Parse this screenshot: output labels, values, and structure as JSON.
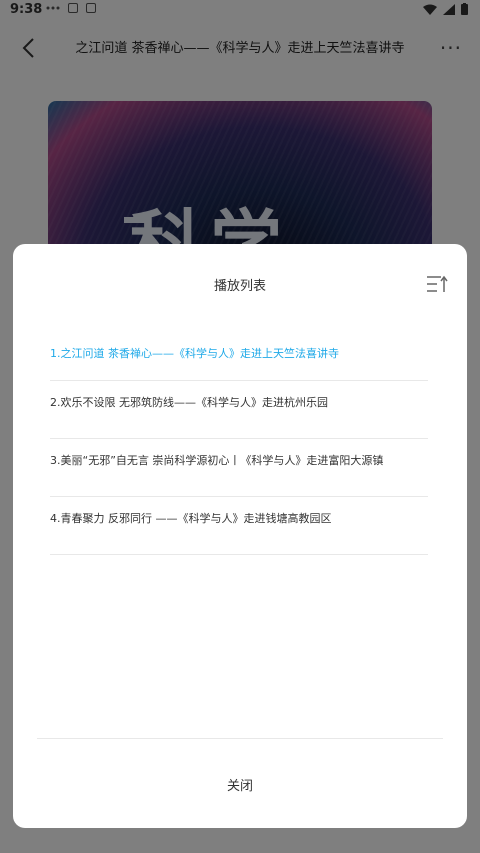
{
  "status_bar": {
    "time": "9:38"
  },
  "header": {
    "title": "之江问道 茶香禅心——《科学与人》走进上天竺法喜讲寺",
    "more_label": "···"
  },
  "hero": {
    "text": "科学"
  },
  "playlist": {
    "title": "播放列表",
    "items": [
      {
        "label": "1.之江问道 茶香禅心——《科学与人》走进上天竺法喜讲寺",
        "active": true
      },
      {
        "label": "2.欢乐不设限 无邪筑防线——《科学与人》走进杭州乐园",
        "active": false
      },
      {
        "label": "3.美丽“无邪”自无言 崇尚科学源初心丨《科学与人》走进富阳大源镇",
        "active": false
      },
      {
        "label": "4.青春聚力 反邪同行 ——《科学与人》走进钱塘高教园区",
        "active": false
      }
    ],
    "close_label": "关闭"
  },
  "colors": {
    "accent": "#1fa9e8",
    "overlay": "rgba(0,0,0,0.5)"
  }
}
